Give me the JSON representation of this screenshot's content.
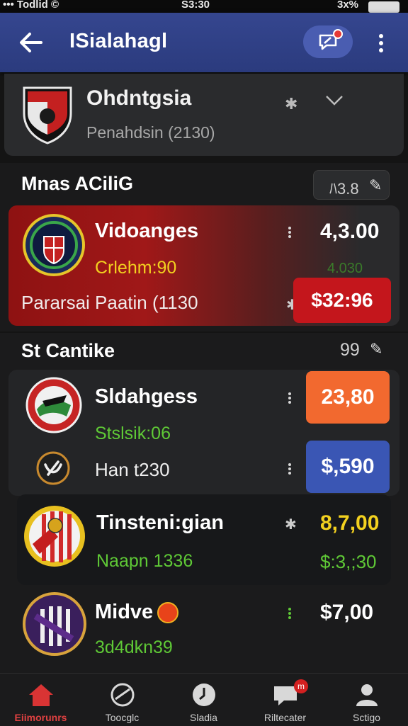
{
  "status_bar": {
    "left": "••• Todlid ©",
    "time": "S3:30",
    "right": "3x%"
  },
  "app_bar": {
    "title": "ISialahagl",
    "icons": [
      "back-arrow-icon",
      "chat-icon",
      "more-vert-icon"
    ],
    "accent": "#35468f"
  },
  "favorite": {
    "name": "Ohdntgsia",
    "subtitle": "Penahdsin (2130)"
  },
  "section1": {
    "title": "Mnas ACiliG",
    "badge": "ﾊ3.8",
    "featured": {
      "name": "Vidoanges",
      "subtitle": "Crlehm:90",
      "odds": "4,3.00",
      "odds_faint": "4.030",
      "detail": "Pararsai Paatin (1130",
      "price": "$32:96"
    }
  },
  "section2": {
    "title": "St Cantike",
    "count": "99",
    "items": [
      {
        "name": "Sldahgess",
        "subtitle": "Stslsik:06",
        "price": "23,80"
      },
      {
        "name": "Han t230",
        "price": "$,590"
      },
      {
        "name": "Tinsteni:gian",
        "subtitle": "Naapn 1336",
        "odds": "8,7,00",
        "odds2": "$:3,;30"
      },
      {
        "name": "Midve",
        "subtitle": "3d4dkn39",
        "odds": "$7,00"
      }
    ]
  },
  "bottom_nav": [
    {
      "label": "Eiimorunrs",
      "icon": "home-icon",
      "active": true
    },
    {
      "label": "Toocglc",
      "icon": "whistle-icon"
    },
    {
      "label": "Sladia",
      "icon": "clock-icon"
    },
    {
      "label": "Riltecater",
      "icon": "chat-notification-icon",
      "badge": "m"
    },
    {
      "label": "Sctigo",
      "icon": "profile-icon"
    }
  ],
  "colors": {
    "active_red": "#e04141",
    "odds_yellow": "#f3d11f",
    "odds_green": "#5fc936",
    "orange": "#f2692f",
    "blue": "#3a56b4"
  }
}
